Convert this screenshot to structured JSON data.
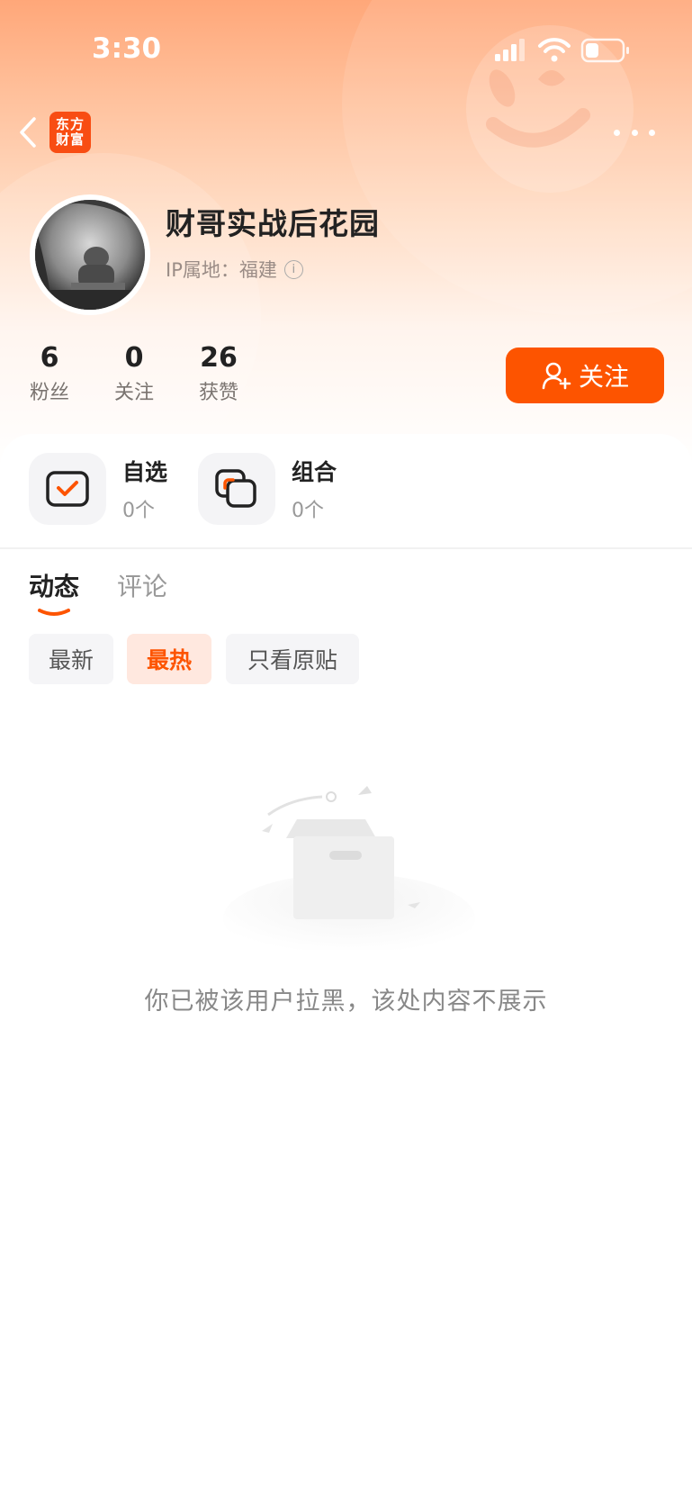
{
  "status_bar": {
    "time": "3:30"
  },
  "header": {
    "logo_line1": "东方",
    "logo_line2": "财富"
  },
  "profile": {
    "name": "财哥实战后花园",
    "ip_label": "IP属地：福建",
    "stats": [
      {
        "value": "6",
        "label": "粉丝"
      },
      {
        "value": "0",
        "label": "关注"
      },
      {
        "value": "26",
        "label": "获赞"
      }
    ],
    "follow_label": "关注"
  },
  "favorites": [
    {
      "title": "自选",
      "count": "0个",
      "icon": "checkbox-icon"
    },
    {
      "title": "组合",
      "count": "0个",
      "icon": "portfolio-icon"
    }
  ],
  "tabs": [
    {
      "label": "动态",
      "active": true
    },
    {
      "label": "评论",
      "active": false
    }
  ],
  "filters": [
    {
      "label": "最新",
      "active": false
    },
    {
      "label": "最热",
      "active": true
    },
    {
      "label": "只看原贴",
      "active": false
    }
  ],
  "empty_state": {
    "message": "你已被该用户拉黑，该处内容不展示"
  },
  "colors": {
    "accent": "#fd5400",
    "header_top": "#ffa779"
  }
}
